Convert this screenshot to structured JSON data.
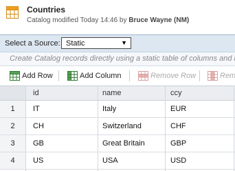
{
  "header": {
    "title": "Countries",
    "subtitle_prefix": "Catalog modified Today 14:46 by",
    "subtitle_user": "Bruce Wayne (NM)"
  },
  "source": {
    "label": "Select a Source:",
    "selected": "Static"
  },
  "hint": "Create Catalog records directly using a static table of columns and ro",
  "toolbar": {
    "add_row": "Add Row",
    "add_column": "Add Column",
    "remove_row": "Remove Row",
    "remove_column": "Rem"
  },
  "table": {
    "columns": [
      "id",
      "name",
      "ccy"
    ],
    "rows": [
      {
        "n": "1",
        "id": "IT",
        "name": "Italy",
        "ccy": "EUR"
      },
      {
        "n": "2",
        "id": "CH",
        "name": "Switzerland",
        "ccy": "CHF"
      },
      {
        "n": "3",
        "id": "GB",
        "name": "Great Britain",
        "ccy": "GBP"
      },
      {
        "n": "4",
        "id": "US",
        "name": "USA",
        "ccy": "USD"
      }
    ]
  },
  "colors": {
    "accent": "#f0a020",
    "sourcebar_bg": "#dde7f1",
    "grid_icon_green": "#3b8a3b",
    "grid_icon_red": "#d9a0a0"
  },
  "icons": {
    "catalog": "catalog-grid-icon",
    "add_row": "add-row-icon",
    "add_column": "add-column-icon",
    "remove_row": "remove-row-icon",
    "remove_column": "remove-column-icon"
  }
}
